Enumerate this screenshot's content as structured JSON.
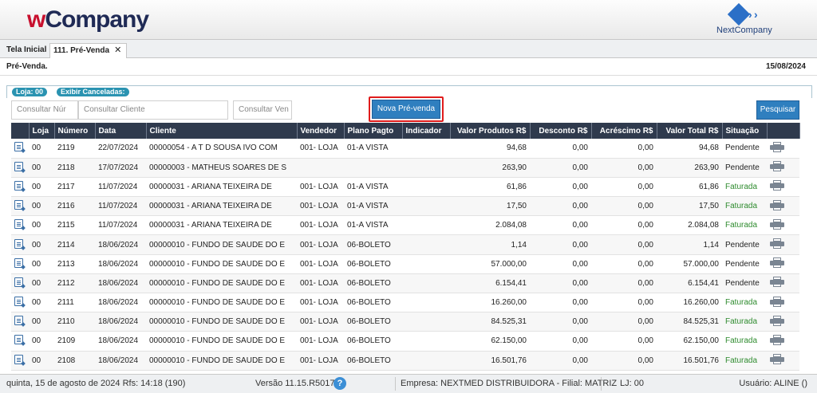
{
  "brand": {
    "left_w": "w",
    "left_rest": "Company",
    "right_name": "NextCompany"
  },
  "tabs": [
    {
      "label": "Tela Inicial"
    },
    {
      "label": "111. Pré-Venda",
      "close": "✕"
    }
  ],
  "page": {
    "title": "Pré-Venda.",
    "date": "15/08/2024"
  },
  "filters": {
    "loja": "Loja: 00",
    "cancel": "Exibir Canceladas:"
  },
  "search": {
    "numero_placeholder": "Consultar Núr",
    "cliente_placeholder": "Consultar Cliente",
    "vendedor_placeholder": "Consultar Ven",
    "nova_label": "Nova Pré-venda",
    "pesquisar_label": "Pesquisar"
  },
  "table": {
    "columns": [
      "",
      "Loja",
      "Número",
      "Data",
      "Cliente",
      "Vendedor",
      "Plano Pagto",
      "Indicador",
      "Valor Produtos R$",
      "Desconto R$",
      "Acréscimo R$",
      "Valor Total R$",
      "Situação",
      ""
    ],
    "rows": [
      {
        "loja": "00",
        "numero": "2119",
        "data": "22/07/2024",
        "cliente": "00000054 - A T D SOUSA IVO COM",
        "vendedor": "001- LOJA",
        "plano": "01-A VISTA",
        "indicador": "",
        "valor_prod": "94,68",
        "desconto": "0,00",
        "acrescimo": "0,00",
        "total": "94,68",
        "situacao": "Pendente"
      },
      {
        "loja": "00",
        "numero": "2118",
        "data": "17/07/2024",
        "cliente": "00000003 - MATHEUS SOARES DE S",
        "vendedor": "",
        "plano": "",
        "indicador": "",
        "valor_prod": "263,90",
        "desconto": "0,00",
        "acrescimo": "0,00",
        "total": "263,90",
        "situacao": "Pendente"
      },
      {
        "loja": "00",
        "numero": "2117",
        "data": "11/07/2024",
        "cliente": "00000031 - ARIANA TEIXEIRA DE",
        "vendedor": "001- LOJA",
        "plano": "01-A VISTA",
        "indicador": "",
        "valor_prod": "61,86",
        "desconto": "0,00",
        "acrescimo": "0,00",
        "total": "61,86",
        "situacao": "Faturada"
      },
      {
        "loja": "00",
        "numero": "2116",
        "data": "11/07/2024",
        "cliente": "00000031 - ARIANA TEIXEIRA DE",
        "vendedor": "001- LOJA",
        "plano": "01-A VISTA",
        "indicador": "",
        "valor_prod": "17,50",
        "desconto": "0,00",
        "acrescimo": "0,00",
        "total": "17,50",
        "situacao": "Faturada"
      },
      {
        "loja": "00",
        "numero": "2115",
        "data": "11/07/2024",
        "cliente": "00000031 - ARIANA TEIXEIRA DE",
        "vendedor": "001- LOJA",
        "plano": "01-A VISTA",
        "indicador": "",
        "valor_prod": "2.084,08",
        "desconto": "0,00",
        "acrescimo": "0,00",
        "total": "2.084,08",
        "situacao": "Faturada"
      },
      {
        "loja": "00",
        "numero": "2114",
        "data": "18/06/2024",
        "cliente": "00000010 - FUNDO DE SAUDE DO E",
        "vendedor": "001- LOJA",
        "plano": "06-BOLETO",
        "indicador": "",
        "valor_prod": "1,14",
        "desconto": "0,00",
        "acrescimo": "0,00",
        "total": "1,14",
        "situacao": "Pendente"
      },
      {
        "loja": "00",
        "numero": "2113",
        "data": "18/06/2024",
        "cliente": "00000010 - FUNDO DE SAUDE DO E",
        "vendedor": "001- LOJA",
        "plano": "06-BOLETO",
        "indicador": "",
        "valor_prod": "57.000,00",
        "desconto": "0,00",
        "acrescimo": "0,00",
        "total": "57.000,00",
        "situacao": "Pendente"
      },
      {
        "loja": "00",
        "numero": "2112",
        "data": "18/06/2024",
        "cliente": "00000010 - FUNDO DE SAUDE DO E",
        "vendedor": "001- LOJA",
        "plano": "06-BOLETO",
        "indicador": "",
        "valor_prod": "6.154,41",
        "desconto": "0,00",
        "acrescimo": "0,00",
        "total": "6.154,41",
        "situacao": "Pendente"
      },
      {
        "loja": "00",
        "numero": "2111",
        "data": "18/06/2024",
        "cliente": "00000010 - FUNDO DE SAUDE DO E",
        "vendedor": "001- LOJA",
        "plano": "06-BOLETO",
        "indicador": "",
        "valor_prod": "16.260,00",
        "desconto": "0,00",
        "acrescimo": "0,00",
        "total": "16.260,00",
        "situacao": "Faturada"
      },
      {
        "loja": "00",
        "numero": "2110",
        "data": "18/06/2024",
        "cliente": "00000010 - FUNDO DE SAUDE DO E",
        "vendedor": "001- LOJA",
        "plano": "06-BOLETO",
        "indicador": "",
        "valor_prod": "84.525,31",
        "desconto": "0,00",
        "acrescimo": "0,00",
        "total": "84.525,31",
        "situacao": "Faturada"
      },
      {
        "loja": "00",
        "numero": "2109",
        "data": "18/06/2024",
        "cliente": "00000010 - FUNDO DE SAUDE DO E",
        "vendedor": "001- LOJA",
        "plano": "06-BOLETO",
        "indicador": "",
        "valor_prod": "62.150,00",
        "desconto": "0,00",
        "acrescimo": "0,00",
        "total": "62.150,00",
        "situacao": "Faturada"
      },
      {
        "loja": "00",
        "numero": "2108",
        "data": "18/06/2024",
        "cliente": "00000010 - FUNDO DE SAUDE DO E",
        "vendedor": "001- LOJA",
        "plano": "06-BOLETO",
        "indicador": "",
        "valor_prod": "16.501,76",
        "desconto": "0,00",
        "acrescimo": "0,00",
        "total": "16.501,76",
        "situacao": "Faturada"
      }
    ]
  },
  "footer": {
    "datetime": "quinta, 15 de agosto de 2024  Rfs: 14:18 (190)",
    "versao": "Versão 11.15.R5017",
    "help": "?",
    "empresa": "Empresa: NEXTMED DISTRIBUIDORA - Filial: MATRIZ",
    "lj": "LJ: 00",
    "usuario": "Usuário: ALINE ()"
  },
  "colors": {
    "header_dark": "#2f3a4d",
    "accent_blue": "#2f7fbf",
    "faturada_green": "#2e8b2e",
    "highlight_red": "#e01c1c"
  }
}
